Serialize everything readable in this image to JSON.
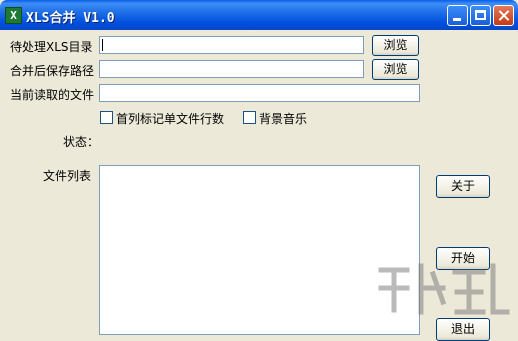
{
  "window": {
    "title": "XLS合并  V1.0",
    "icon": "excel-icon"
  },
  "form": {
    "source_dir_label": "待处理XLS目录",
    "source_dir_value": "",
    "browse_label_1": "浏览",
    "save_path_label": "合并后保存路径",
    "save_path_value": "",
    "browse_label_2": "浏览",
    "current_file_label": "当前读取的文件",
    "current_file_value": "",
    "checkbox_first_col_label": "首列标记单文件行数",
    "checkbox_first_col_checked": false,
    "checkbox_music_label": "背景音乐",
    "checkbox_music_checked": false,
    "status_label": "状态：",
    "file_list_label": "文件列表"
  },
  "buttons": {
    "about": "关于",
    "start": "开始",
    "exit": "退出"
  },
  "colors": {
    "titlebar": "#0a5ee8",
    "face": "#ece9d8",
    "border": "#7f9db9"
  }
}
